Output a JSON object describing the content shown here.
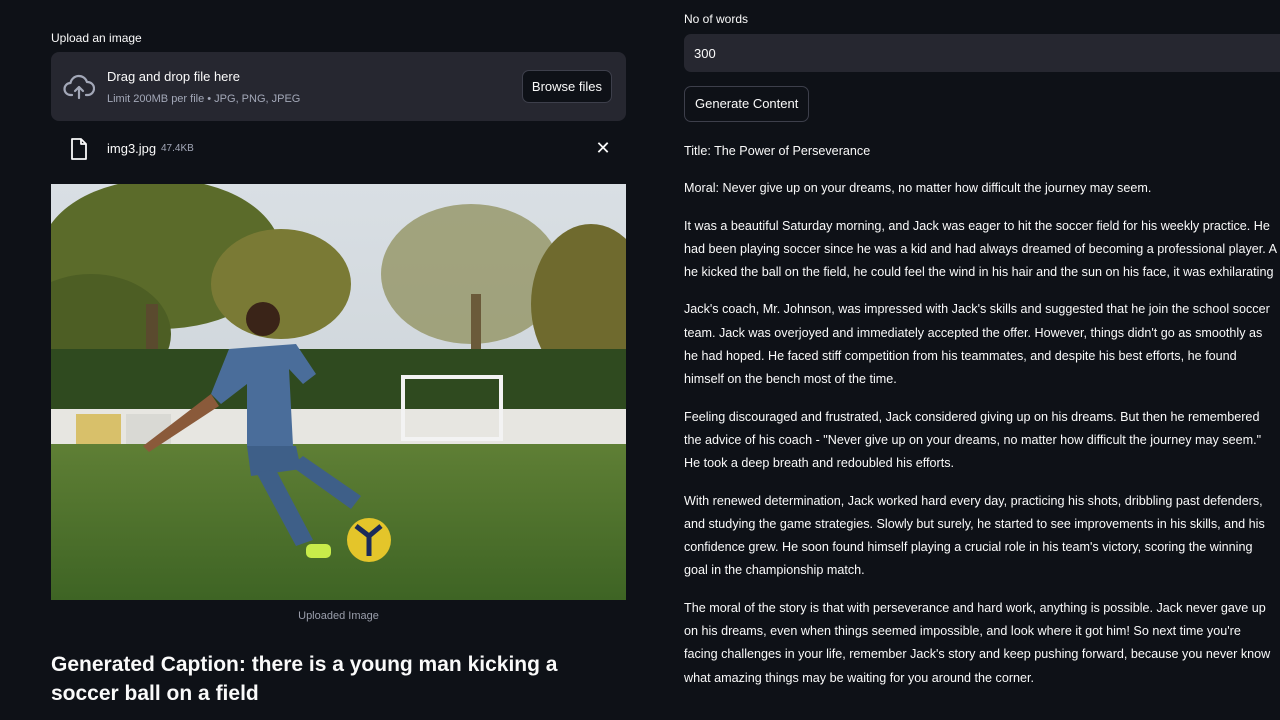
{
  "uploader": {
    "label": "Upload an image",
    "drop_title": "Drag and drop file here",
    "drop_limits": "Limit 200MB per file • JPG, PNG, JPEG",
    "browse_label": "Browse files",
    "upload_icon": "cloud-upload-icon"
  },
  "file": {
    "name": "img3.jpg",
    "size": "47.4KB",
    "file_icon": "file-icon",
    "remove_icon": "close-icon",
    "remove_glyph": "✕"
  },
  "image": {
    "caption": "Uploaded Image"
  },
  "generated_caption": "Generated Caption: there is a young man kicking a soccer ball on a field",
  "controls": {
    "words_label": "No of words",
    "words_value": "300",
    "generate_label": "Generate Content"
  },
  "story": {
    "title": "Title: The Power of Perseverance",
    "moral": "Moral: Never give up on your dreams, no matter how difficult the journey may seem.",
    "paragraphs": [
      [
        "It was a beautiful Saturday morning, and Jack was eager to hit the soccer field for his weekly practice. He",
        "had been playing soccer since he was a kid and had always dreamed of becoming a professional player. A",
        "he kicked the ball on the field, he could feel the wind in his hair and the sun on his face, it was exhilarating"
      ],
      [
        "Jack's coach, Mr. Johnson, was impressed with Jack's skills and suggested that he join the school soccer",
        "team. Jack was overjoyed and immediately accepted the offer. However, things didn't go as smoothly as",
        "he had hoped. He faced stiff competition from his teammates, and despite his best efforts, he found",
        "himself on the bench most of the time."
      ],
      [
        "Feeling discouraged and frustrated, Jack considered giving up on his dreams. But then he remembered",
        "the advice of his coach - \"Never give up on your dreams, no matter how difficult the journey may seem.\"",
        "He took a deep breath and redoubled his efforts."
      ],
      [
        "With renewed determination, Jack worked hard every day, practicing his shots, dribbling past defenders,",
        "and studying the game strategies. Slowly but surely, he started to see improvements in his skills, and his",
        "confidence grew. He soon found himself playing a crucial role in his team's victory, scoring the winning",
        "goal in the championship match."
      ],
      [
        "The moral of the story is that with perseverance and hard work, anything is possible. Jack never gave up",
        "on his dreams, even when things seemed impossible, and look where it got him! So next time you're",
        "facing challenges in your life, remember Jack's story and keep pushing forward, because you never know",
        "what amazing things may be waiting for you around the corner."
      ]
    ]
  },
  "colors": {
    "background": "#0e1117",
    "panel": "#262730",
    "text": "#fafafa",
    "muted": "#a3a8b8"
  }
}
